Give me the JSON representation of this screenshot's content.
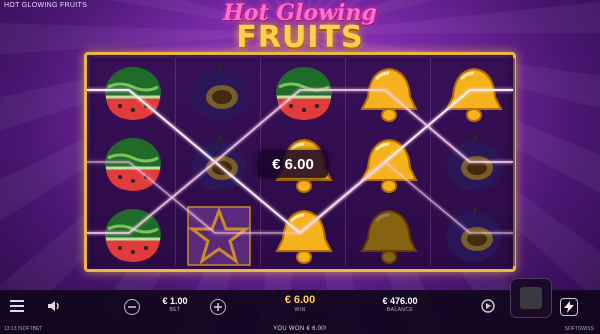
{
  "game": {
    "title_small": "HOT GLOWING FRUITS",
    "logo_line1": "Hot Glowing",
    "logo_line2": "FRUITS"
  },
  "reels": [
    [
      "watermelon",
      "watermelon",
      "watermelon"
    ],
    [
      "plum",
      "plum",
      "star"
    ],
    [
      "watermelon",
      "bell",
      "bell"
    ],
    [
      "bell",
      "bell",
      "bell"
    ],
    [
      "bell",
      "plum",
      "plum"
    ]
  ],
  "win_badge": "€ 6.00",
  "bottom": {
    "bet_value": "€ 1.00",
    "bet_label": "BET",
    "win_value": "€ 6.00",
    "win_label": "WIN",
    "balance_value": "€ 476.00",
    "balance_label": "BALANCE"
  },
  "footer": {
    "message": "YOU WON € 6.00!",
    "left": "13:13  ISOFTBET",
    "right": "SOFTSWISS"
  },
  "colors": {
    "frame": "#e9b844",
    "win_gold": "#ffd24a",
    "background": "#7a2aa8"
  }
}
